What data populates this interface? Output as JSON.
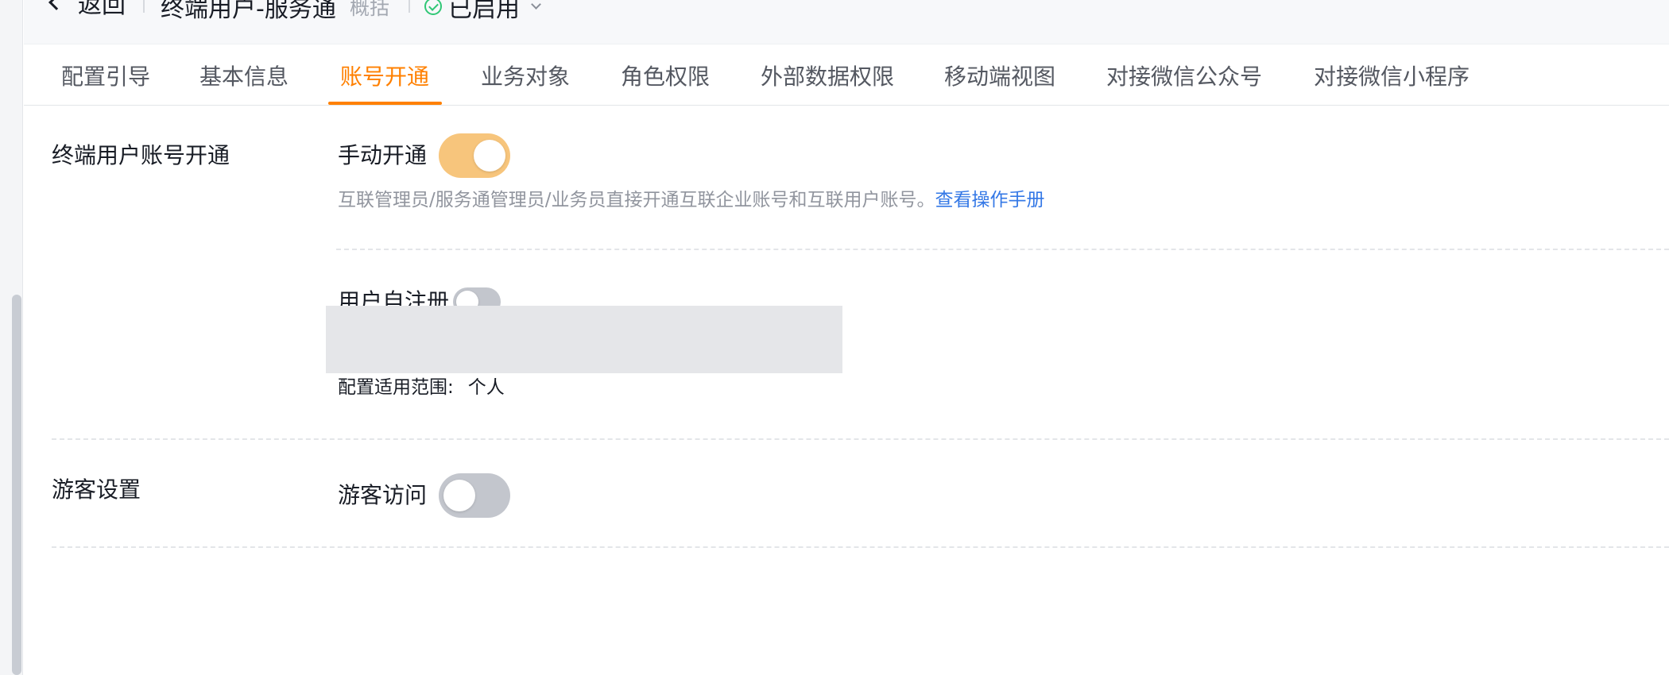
{
  "header": {
    "back_label": "返回",
    "object_name": "终端用户-服务通",
    "object_subtitle": "概括",
    "status_label": "已启用",
    "status_color": "#30c776"
  },
  "tabs": {
    "active_color": "#ff8000",
    "items": [
      {
        "label": "配置引导"
      },
      {
        "label": "基本信息"
      },
      {
        "label": "账号开通",
        "active": true
      },
      {
        "label": "业务对象"
      },
      {
        "label": "角色权限"
      },
      {
        "label": "外部数据权限"
      },
      {
        "label": "移动端视图"
      },
      {
        "label": "对接微信公众号"
      },
      {
        "label": "对接微信小程序"
      }
    ]
  },
  "account_section": {
    "title": "终端用户账号开通",
    "manual": {
      "label": "手动开通",
      "enabled": true,
      "description": "互联管理员/服务通管理员/业务员直接开通互联企业账号和互联用户账号。",
      "link_label": "查看操作手册"
    },
    "self_register": {
      "label": "用户自注册",
      "enabled": false
    },
    "scope": {
      "label": "配置适用范围:",
      "value": "个人"
    }
  },
  "guest_section": {
    "title": "游客设置",
    "visit": {
      "label": "游客访问",
      "enabled": false
    }
  },
  "colors": {
    "switch_on": "#f7c57c",
    "switch_off": "#c3c6cd",
    "link": "#3478e6"
  }
}
